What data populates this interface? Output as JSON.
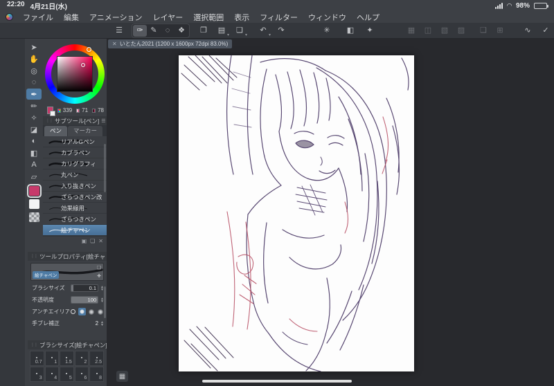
{
  "ui_colors": {
    "accent": "#4e7ba4",
    "primary_color": "#c73a6b",
    "panel": "#3c3f44"
  },
  "status_bar": {
    "time": "22:20",
    "date": "4月21日(水)",
    "battery_percent": "98%"
  },
  "menu_bar": {
    "items": [
      "ファイル",
      "編集",
      "アニメーション",
      "レイヤー",
      "選択範囲",
      "表示",
      "フィルター",
      "ウィンドウ",
      "ヘルプ"
    ]
  },
  "toolbar": {
    "items": [
      {
        "name": "main-menu-icon",
        "glyph": "☰",
        "gap": 0
      },
      {
        "name": "tool-mode-group",
        "group": [
          {
            "name": "brush-mode-icon",
            "glyph": "✑",
            "active": true
          },
          {
            "name": "pen-mode-icon",
            "glyph": "✎"
          },
          {
            "name": "select-mode-icon",
            "glyph": "◌"
          },
          {
            "name": "deco-mode-icon",
            "glyph": "❖"
          }
        ]
      },
      {
        "name": "export-icon",
        "glyph": "❐",
        "gap": 10
      },
      {
        "name": "folder-icon",
        "glyph": "▤",
        "gap": 6,
        "chevron": true
      },
      {
        "name": "save-icon",
        "glyph": "❏",
        "gap": 6,
        "chevron": true
      },
      {
        "name": "undo-icon",
        "glyph": "↶",
        "gap": 14,
        "chevron": true
      },
      {
        "name": "redo-icon",
        "glyph": "↷",
        "gap": 6
      },
      {
        "name": "timelapse-icon",
        "glyph": "✳",
        "gap": 46
      },
      {
        "name": "fill-icon",
        "glyph": "◧",
        "gap": 14
      },
      {
        "name": "blend-drop-icon",
        "glyph": "✦",
        "gap": 8
      },
      {
        "name": "select-rect-icon",
        "glyph": "▦",
        "gap": 40,
        "disabled": true
      },
      {
        "name": "select-move-icon",
        "glyph": "◫",
        "gap": 4,
        "disabled": true
      },
      {
        "name": "select-invert-icon",
        "glyph": "▧",
        "gap": 4,
        "disabled": true
      },
      {
        "name": "select-clear-icon",
        "glyph": "▨",
        "gap": 4,
        "disabled": true
      },
      {
        "name": "transform-icon",
        "glyph": "❑",
        "gap": 12,
        "disabled": true
      },
      {
        "name": "mesh-icon",
        "glyph": "⊞",
        "gap": 4,
        "disabled": true
      },
      {
        "name": "line-correct-icon",
        "glyph": "∿",
        "gap": 20
      },
      {
        "name": "snap-check-icon",
        "glyph": "✓",
        "gap": 6
      },
      {
        "name": "stylus-check-icon",
        "glyph": "✔",
        "gap": 6
      },
      {
        "name": "reference-pen-icon",
        "glyph": "✐",
        "gap": 22
      }
    ]
  },
  "document_tab": {
    "close": "✕",
    "title": "いとたん2021 (1200 x 1600px 72dpi 83.0%)"
  },
  "tool_strip": {
    "tools": [
      {
        "name": "operate-tool",
        "glyph": "➤"
      },
      {
        "name": "move-tool",
        "glyph": "✋"
      },
      {
        "name": "zoom-tool",
        "glyph": "◎"
      },
      {
        "name": "selection-tool",
        "glyph": "◌"
      },
      {
        "name": "pen-tool",
        "glyph": "✒",
        "selected": true
      },
      {
        "name": "pencil-tool",
        "glyph": "✏"
      },
      {
        "name": "airbrush-tool",
        "glyph": "✧"
      },
      {
        "name": "eraser-tool",
        "glyph": "◪"
      },
      {
        "name": "blend-tool",
        "glyph": "◐"
      },
      {
        "name": "fill-tool",
        "glyph": "◧"
      },
      {
        "name": "text-tool",
        "glyph": "A"
      },
      {
        "name": "figure-tool",
        "glyph": "▱"
      }
    ]
  },
  "color_panel": {
    "hue": "339",
    "saturation": "71",
    "value": "78"
  },
  "subtool_panel": {
    "title": "サブツール[ペン]",
    "tabs": [
      {
        "label": "ペン",
        "active": true
      },
      {
        "label": "マーカー"
      }
    ],
    "pens": [
      {
        "name": "リアルGペン",
        "weight": 2.6
      },
      {
        "name": "カブラペン",
        "weight": 2.1
      },
      {
        "name": "カリグラフィ",
        "weight": 3.0
      },
      {
        "name": "丸ペン",
        "weight": 1.3
      },
      {
        "name": "入り抜きペン",
        "weight": 1.8
      },
      {
        "name": "ざらつきペン改",
        "weight": 2.3
      },
      {
        "name": "効果線用",
        "weight": 0.9
      },
      {
        "name": "ざらつきペン",
        "weight": 1.6
      },
      {
        "name": "絵チャペン",
        "weight": 1.1,
        "selected": true
      }
    ],
    "footer_icons": [
      "▣",
      "❏",
      "✕"
    ]
  },
  "tool_property_panel": {
    "title": "ツールプロパティ[絵チャ",
    "brush_name": "絵チャペン",
    "properties": [
      {
        "label": "ブラシサイズ",
        "value": "0.1",
        "type": "slider",
        "fill": 0.07
      },
      {
        "label": "不透明度",
        "value": "100",
        "type": "slider",
        "fill": 1
      },
      {
        "label": "アンチエイリアス",
        "type": "choices",
        "selected_index": 1
      },
      {
        "label": "手ブレ補正",
        "value": "2",
        "type": "stepper"
      }
    ]
  },
  "brush_size_panel": {
    "title": "ブラシサイズ[絵チャペン]",
    "rows": [
      [
        "0.7",
        "1",
        "1.5",
        "2",
        "2.5"
      ],
      [
        "3",
        "4",
        "5",
        "6",
        "8"
      ]
    ]
  }
}
